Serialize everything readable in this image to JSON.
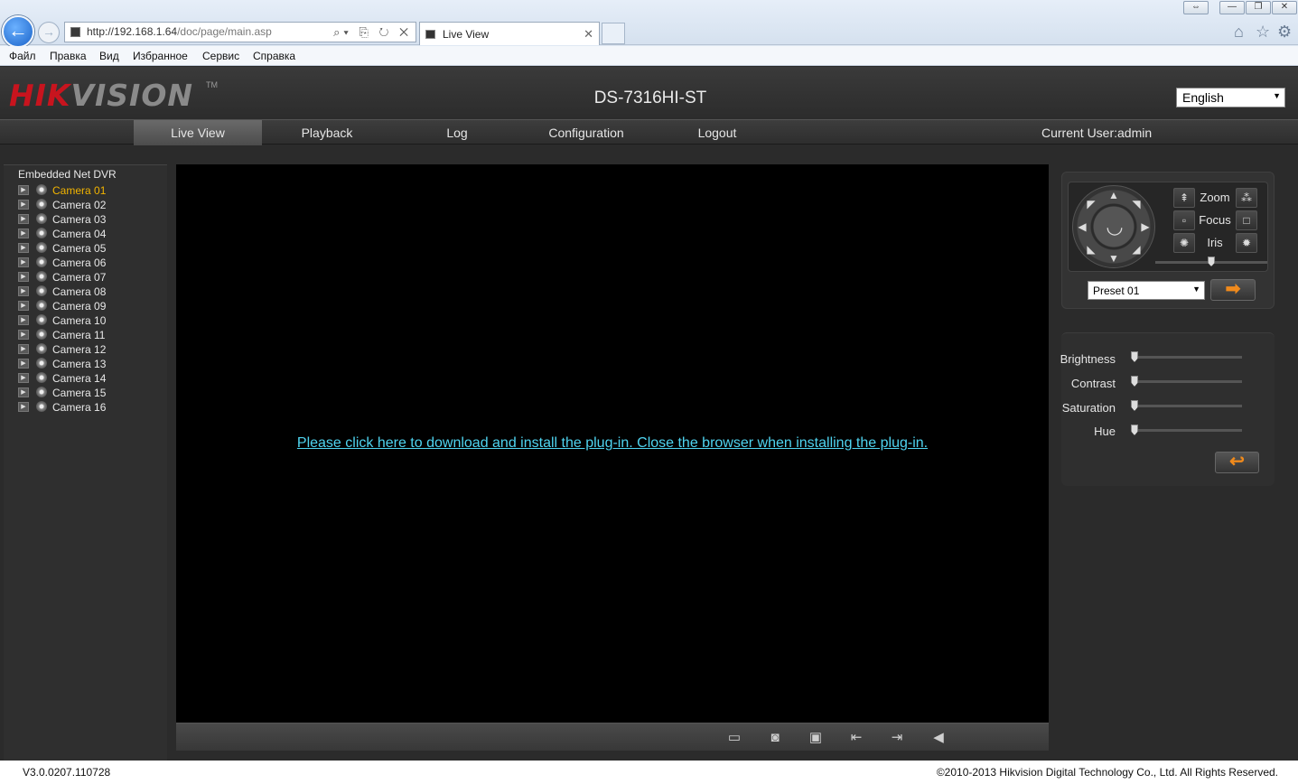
{
  "browser": {
    "url_host": "http://192.168.1.64",
    "url_path": "/doc/page/main.asp",
    "tab_title": "Live View",
    "menu": [
      "Файл",
      "Правка",
      "Вид",
      "Избранное",
      "Сервис",
      "Справка"
    ],
    "icons": {
      "back": "back-arrow-icon",
      "forward": "forward-arrow-icon",
      "home": "home-icon",
      "favorites": "star-icon",
      "tools": "gear-icon"
    }
  },
  "header": {
    "logo_hik": "HIK",
    "logo_vision": "VISION",
    "logo_tm": "TM",
    "device_name": "DS-7316HI-ST",
    "language": "English"
  },
  "nav": {
    "items": [
      "Live View",
      "Playback",
      "Log",
      "Configuration",
      "Logout"
    ],
    "active": "Live View",
    "current_user": "Current User:admin"
  },
  "tree": {
    "title": "Embedded Net DVR",
    "cameras": [
      "Camera 01",
      "Camera 02",
      "Camera 03",
      "Camera 04",
      "Camera 05",
      "Camera 06",
      "Camera 07",
      "Camera 08",
      "Camera 09",
      "Camera 10",
      "Camera 11",
      "Camera 12",
      "Camera 13",
      "Camera 14",
      "Camera 15",
      "Camera 16"
    ],
    "active_camera": "Camera 01",
    "active_color": "#f2b400"
  },
  "video": {
    "plugin_message": "Please click here to download and install the plug-in. Close the browser when installing the plug-in.",
    "link_color": "#4fd4f0",
    "toolbar_icons": [
      "start-all-live-icon",
      "capture-icon",
      "record-icon",
      "previous-page-icon",
      "next-page-icon",
      "audio-muted-icon"
    ]
  },
  "ptz": {
    "zoom_label": "Zoom",
    "focus_label": "Focus",
    "iris_label": "Iris",
    "speed_level": 0.5,
    "preset_selected": "Preset 01"
  },
  "image_adjust": {
    "brightness_label": "Brightness",
    "contrast_label": "Contrast",
    "saturation_label": "Saturation",
    "hue_label": "Hue",
    "brightness": 0,
    "contrast": 0,
    "saturation": 0,
    "hue": 0
  },
  "footer": {
    "version": "V3.0.0207.110728",
    "copyright": "©2010-2013 Hikvision Digital Technology Co., Ltd. All Rights Reserved."
  },
  "colors": {
    "brand_red": "#c8141e",
    "accent_orange": "#f08a1c"
  }
}
